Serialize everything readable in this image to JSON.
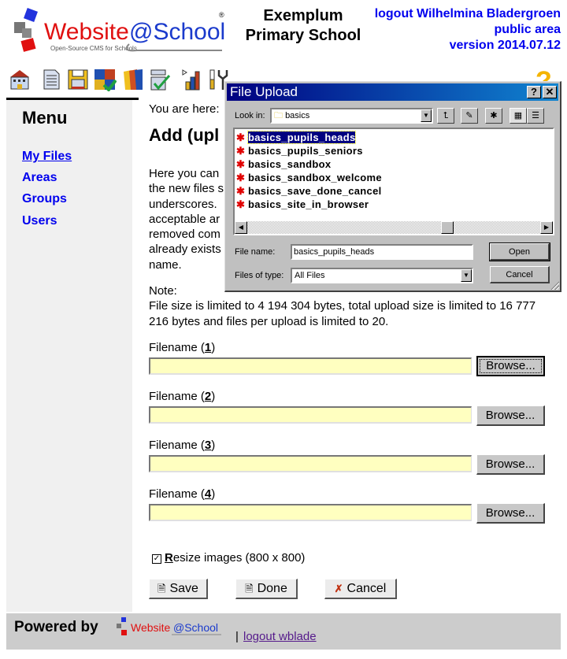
{
  "header": {
    "logo_alt": "Website@School - Open-Source CMS for Schools",
    "logo_word1": "Website",
    "logo_word2": "@School",
    "logo_tagline": "Open-Source CMS for Schools",
    "school_name_line1": "Exemplum",
    "school_name_line2": "Primary School",
    "logout_link": "logout Wilhelmina Bladergroen",
    "area_link": "public area",
    "version_link": "version 2014.07.12"
  },
  "toolbar": {
    "icons": [
      "home-icon",
      "page-icon",
      "floppy-save-icon",
      "modules-puzzle-icon",
      "users-faces-icon",
      "checklist-icon",
      "statistics-chart-icon",
      "tools-icon"
    ],
    "help_icon": "?"
  },
  "sidebar": {
    "title": "Menu",
    "items": [
      {
        "label": "My Files",
        "active": true
      },
      {
        "label": "Areas",
        "active": false
      },
      {
        "label": "Groups",
        "active": false
      },
      {
        "label": "Users",
        "active": false
      }
    ]
  },
  "content": {
    "breadcrumb": "You are here:",
    "title": "Add (upl",
    "intro_lines": [
      "Here you can",
      "the new files s",
      "underscores.",
      "acceptable ar",
      "removed com",
      "already exists",
      "name."
    ],
    "note_label": "Note:",
    "note_text": "File size is limited to 4 194 304 bytes, total upload size is limited to 16 777 216 bytes and files per upload is limited to 20.",
    "filename_label": "Filename",
    "files": [
      {
        "index": "1",
        "value": "",
        "browse_label": "Browse..."
      },
      {
        "index": "2",
        "value": "",
        "browse_label": "Browse..."
      },
      {
        "index": "3",
        "value": "",
        "browse_label": "Browse..."
      },
      {
        "index": "4",
        "value": "",
        "browse_label": "Browse..."
      }
    ],
    "resize_checked": true,
    "resize_accesskey": "R",
    "resize_label_rest": "esize images (800 x 800)",
    "buttons": {
      "save": "Save",
      "done": "Done",
      "cancel": "Cancel"
    }
  },
  "footer": {
    "powered_by": "Powered by",
    "separator": "|",
    "logout_link": "logout wblade"
  },
  "dialog": {
    "title": "File Upload",
    "help_btn": "?",
    "close_btn": "✕",
    "look_in_label": "Look in:",
    "look_in_value": "basics",
    "files": [
      {
        "name": "basics_pupils_heads",
        "selected": true
      },
      {
        "name": "basics_pupils_seniors",
        "selected": false
      },
      {
        "name": "basics_sandbox",
        "selected": false
      },
      {
        "name": "basics_sandbox_welcome",
        "selected": false
      },
      {
        "name": "basics_save_done_cancel",
        "selected": false
      },
      {
        "name": "basics_site_in_browser",
        "selected": false
      }
    ],
    "file_name_label": "File name:",
    "file_name_value": "basics_pupils_heads",
    "files_of_type_label": "Files of type:",
    "files_of_type_value": "All Files",
    "open_btn": "Open",
    "cancel_btn": "Cancel"
  }
}
